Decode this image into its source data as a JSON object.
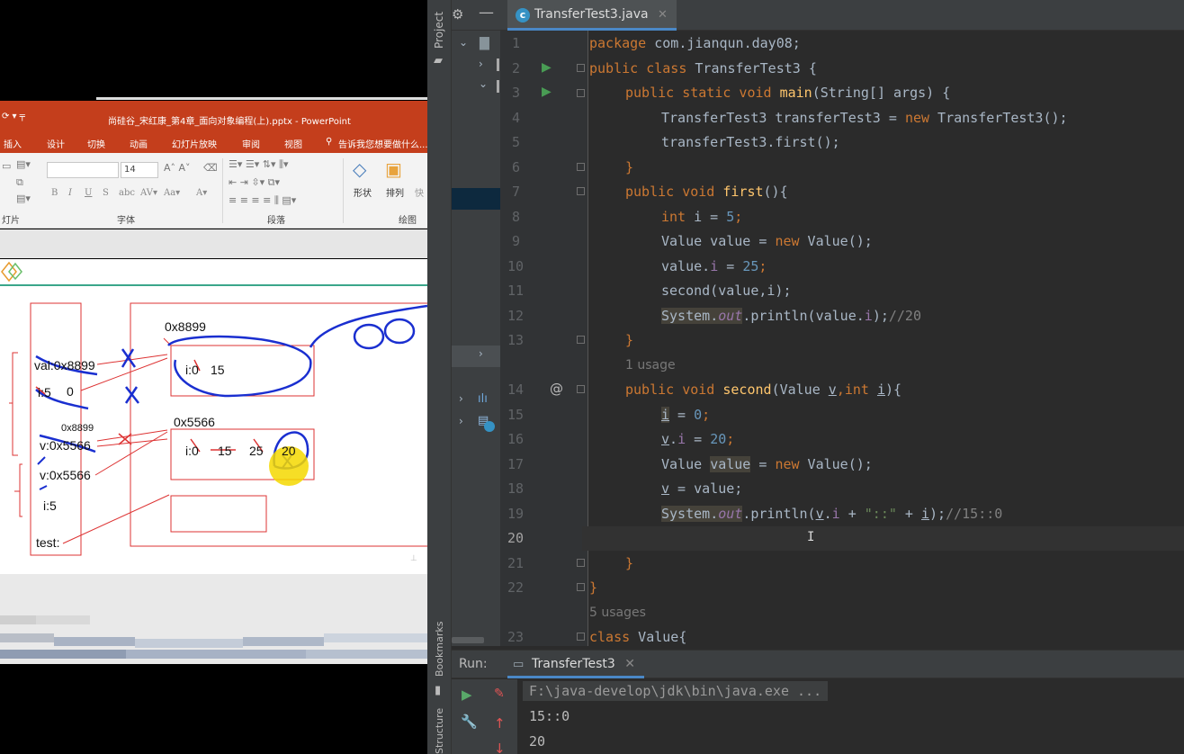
{
  "ppt": {
    "title": "尚硅谷_宋红康_第4章_面向对象编程(上).pptx - PowerPoint",
    "quick_access": "⟳ ▾  ╤",
    "tabs": [
      "插入",
      "设计",
      "切换",
      "动画",
      "幻灯片放映",
      "审阅",
      "视图"
    ],
    "tell_me": "告诉我您想要做什么...",
    "font_size": "14",
    "groups": {
      "slides": "灯片",
      "font": "字体",
      "paragraph": "段落",
      "drawing": "绘图"
    },
    "buttons": {
      "shape": "形状",
      "arrange": "排列",
      "quick": "快"
    },
    "diagram": {
      "heap_addr_1": "0x8899",
      "heap_addr_2": "0x5566",
      "stack_val": "val:0x8899",
      "stack_i": "i:5",
      "stack_i_new": "0",
      "stack_v1_small": "0x8899",
      "stack_v1": "v:0x5566",
      "stack_v2": "v:0x5566",
      "stack_i2": "i:5",
      "stack_test": "test:",
      "obj1_i": "i:0",
      "obj1_val": "15",
      "obj2_i": "i:0",
      "obj2_v1": "15",
      "obj2_v2": "25",
      "obj2_v3": "20"
    }
  },
  "ide": {
    "sidebar": {
      "project": "Project",
      "bookmarks": "Bookmarks",
      "structure": "Structure"
    },
    "file_tab": "TransferTest3.java",
    "lines": [
      {
        "n": "1"
      },
      {
        "n": "2"
      },
      {
        "n": "3"
      },
      {
        "n": "4"
      },
      {
        "n": "5"
      },
      {
        "n": "6"
      },
      {
        "n": "7"
      },
      {
        "n": "8"
      },
      {
        "n": "9"
      },
      {
        "n": "10"
      },
      {
        "n": "11"
      },
      {
        "n": "12"
      },
      {
        "n": "13"
      },
      {
        "n": "14"
      },
      {
        "n": "15"
      },
      {
        "n": "16"
      },
      {
        "n": "17"
      },
      {
        "n": "18"
      },
      {
        "n": "19"
      },
      {
        "n": "20"
      },
      {
        "n": "21"
      },
      {
        "n": "22"
      },
      {
        "n": "23"
      }
    ],
    "code": {
      "l1_kw": "package",
      "l1_rest": " com.jianqun.day08;",
      "l2_kw": "public class",
      "l2_name": " TransferTest3 {",
      "l3_kw": "public static void",
      "l3_fn": "main",
      "l3_rest": "(String[] args) {",
      "l4_a": "TransferTest3 transferTest3 = ",
      "l4_kw": "new",
      "l4_b": " TransferTest3();",
      "l5": "transferTest3.first();",
      "l6": "}",
      "l7_kw": "public void",
      "l7_fn": "first",
      "l7_rest": "(){",
      "l8_kw": "int",
      "l8_a": " i = ",
      "l8_num": "5",
      "l8_b": ";",
      "l9_a": "Value value = ",
      "l9_kw": "new",
      "l9_b": " Value();",
      "l10_a": "value.",
      "l10_f": "i",
      "l10_b": " = ",
      "l10_num": "25",
      "l10_c": ";",
      "l11": "second(value,i);",
      "l12_sys": "System",
      "l12_dot": ".",
      "l12_out": "out",
      "l12_a": ".println(value.",
      "l12_f": "i",
      "l12_b": ");",
      "l12_cm": "//20",
      "l13": "}",
      "usage1": "1 usage",
      "l14_kw": "public void",
      "l14_fn": "second",
      "l14_a": "(Value ",
      "l14_v": "v",
      "l14_b": ",",
      "l14_kw2": "int",
      "l14_c": " ",
      "l14_i": "i",
      "l14_d": "){",
      "l15_i": "i",
      "l15_a": " = ",
      "l15_num": "0",
      "l15_b": ";",
      "l16_v": "v",
      "l16_a": ".",
      "l16_f": "i",
      "l16_b": " = ",
      "l16_num": "20",
      "l16_c": ";",
      "l17_a": "Value ",
      "l17_val": "value",
      "l17_b": " = ",
      "l17_kw": "new",
      "l17_c": " Value();",
      "l18_v": "v",
      "l18_a": " = value;",
      "l19_sys": "System",
      "l19_dot": ".",
      "l19_out": "out",
      "l19_a": ".println(",
      "l19_v": "v",
      "l19_b": ".",
      "l19_f": "i",
      "l19_c": " + ",
      "l19_str": "\"::\"",
      "l19_d": " + ",
      "l19_i": "i",
      "l19_e": ");",
      "l19_cm": "//15::0",
      "l21": "}",
      "l22": "}",
      "usage2": "5 usages",
      "l23_kw": "class",
      "l23_rest": " Value{"
    },
    "caret_glyph": "I",
    "run": {
      "label": "Run:",
      "tab": "TransferTest3",
      "command": "F:\\java-develop\\jdk\\bin\\java.exe ...",
      "output": [
        "15::0",
        "20"
      ]
    },
    "colors": {
      "keyword": "#cc7832",
      "function": "#ffc66d",
      "number": "#6897bb",
      "string": "#6a8759",
      "comment": "#808080",
      "field": "#9876aa",
      "run_green": "#59a869",
      "stop_red": "#e05555"
    },
    "icons": [
      "gear-icon",
      "minimize-icon",
      "run-icon",
      "wrench-icon",
      "up-arrow-icon",
      "clear-icon",
      "java-class-icon",
      "folder-icon",
      "bookmark-icon"
    ]
  }
}
